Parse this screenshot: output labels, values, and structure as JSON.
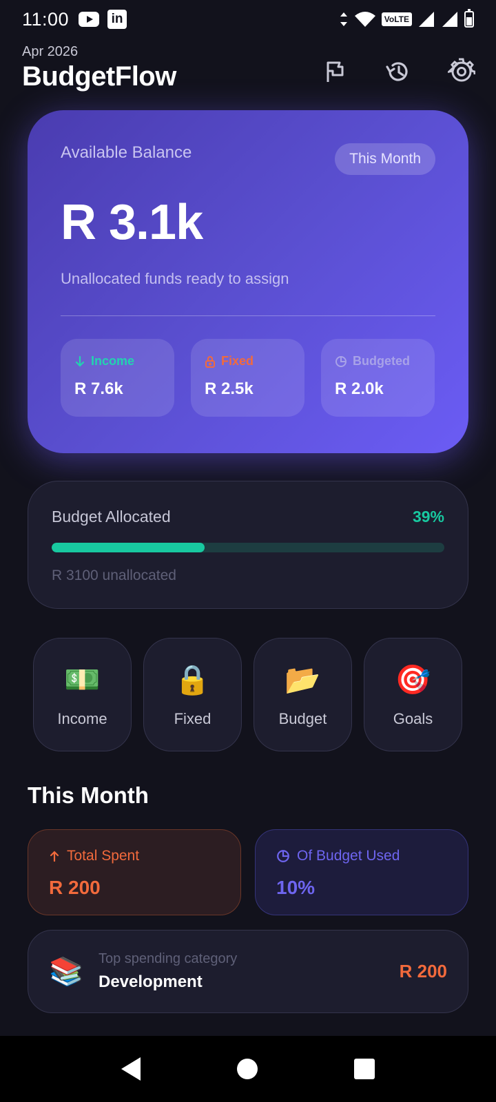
{
  "status_bar": {
    "time": "11:00",
    "left_icons": [
      "youtube-icon",
      "linkedin-icon"
    ],
    "right_icons": [
      "data-arrows-icon",
      "wifi-icon",
      "volte-icon",
      "signal-icon",
      "signal-icon",
      "battery-icon"
    ],
    "volte_label": "VoLTE",
    "linkedin_label": "in"
  },
  "header": {
    "date": "Apr 2026",
    "title": "BudgetFlow",
    "actions": [
      "flag-icon",
      "history-icon",
      "settings-icon"
    ]
  },
  "balance": {
    "label": "Available Balance",
    "period_chip": "This Month",
    "amount": "R 3.1k",
    "subtitle": "Unallocated funds ready to assign",
    "tiles": [
      {
        "label": "Income",
        "value": "R 7.6k",
        "icon": "arrow-down-icon",
        "color": "#22d3b0"
      },
      {
        "label": "Fixed",
        "value": "R 2.5k",
        "icon": "lock-icon",
        "color": "#f26a3c"
      },
      {
        "label": "Budgeted",
        "value": "R 2.0k",
        "icon": "pie-icon",
        "color": "#a8a2e8"
      }
    ],
    "colors": {
      "gradient_start": "#4a3cb0",
      "gradient_end": "#6b5cf5"
    }
  },
  "allocated": {
    "label": "Budget Allocated",
    "percent_text": "39%",
    "percent_value": 39,
    "unallocated_text": "R 3100 unallocated",
    "color": "#18c9a0"
  },
  "quick_actions": [
    {
      "label": "Income",
      "emoji": "💵",
      "icon": "money-icon"
    },
    {
      "label": "Fixed",
      "emoji": "🔒",
      "icon": "lock-icon"
    },
    {
      "label": "Budget",
      "emoji": "📂",
      "icon": "folder-icon"
    },
    {
      "label": "Goals",
      "emoji": "🎯",
      "icon": "target-icon"
    }
  ],
  "this_month": {
    "title": "This Month",
    "spent": {
      "label": "Total Spent",
      "value": "R 200",
      "color": "#f26a3c"
    },
    "used": {
      "label": "Of Budget Used",
      "value": "10%",
      "color": "#6e65f0"
    },
    "top_category": {
      "label": "Top spending category",
      "name": "Development",
      "amount": "R 200",
      "emoji": "📚"
    }
  },
  "navigation": [
    "back-button",
    "home-button",
    "recents-button"
  ]
}
